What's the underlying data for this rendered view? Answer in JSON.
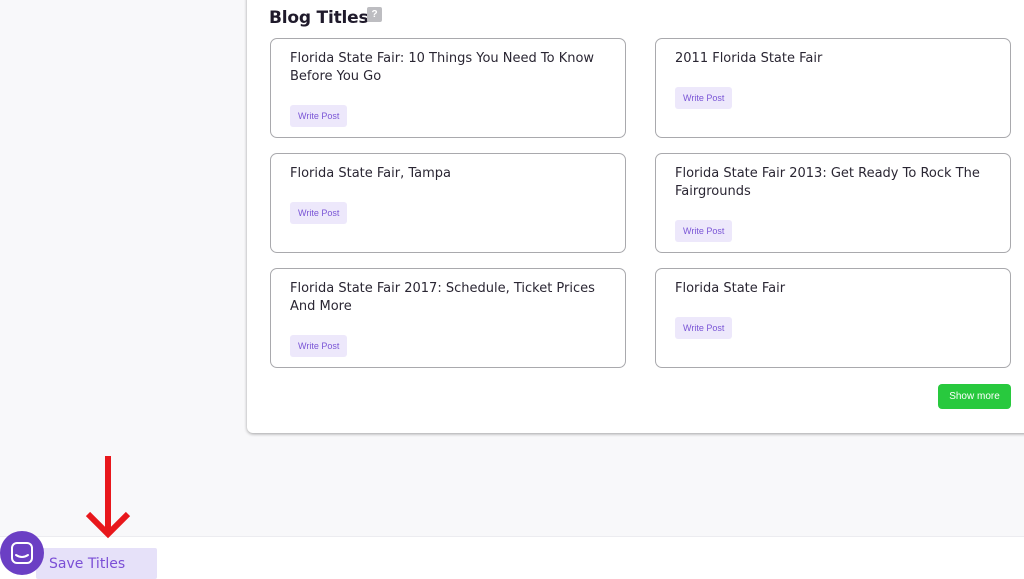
{
  "section": {
    "title": "Blog Titles",
    "help_glyph": "?"
  },
  "cards": [
    {
      "title": "Florida State Fair: 10 Things You Need To Know Before You Go",
      "button": "Write Post"
    },
    {
      "title": "2011 Florida State Fair",
      "button": "Write Post"
    },
    {
      "title": "Florida State Fair, Tampa",
      "button": "Write Post"
    },
    {
      "title": "Florida State Fair 2013: Get Ready To Rock The Fairgrounds",
      "button": "Write Post"
    },
    {
      "title": "Florida State Fair 2017: Schedule, Ticket Prices And More",
      "button": "Write Post"
    },
    {
      "title": "Florida State Fair",
      "button": "Write Post"
    }
  ],
  "show_more_label": "Show more",
  "footer": {
    "save_titles_label": "Save Titles"
  },
  "icons": {
    "help": "question-mark-icon",
    "chat": "chat-launcher-icon",
    "annotation": "red-down-arrow-icon"
  },
  "colors": {
    "accent_purple": "#7a55d6",
    "button_tint": "#ede8fb",
    "show_more_green": "#28c93e",
    "arrow_red": "#e8171c",
    "chat_purple": "#6b3fc4"
  }
}
